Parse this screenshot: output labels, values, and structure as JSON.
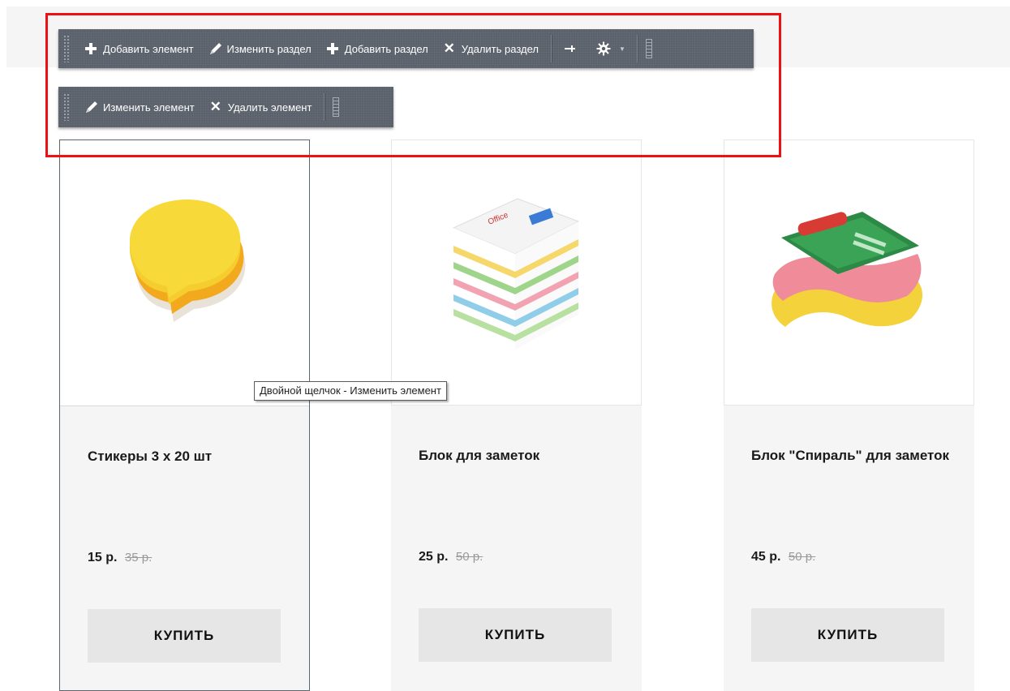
{
  "toolbar_section": {
    "add_element": "Добавить элемент",
    "edit_section": "Изменить раздел",
    "add_section": "Добавить раздел",
    "delete_section": "Удалить раздел"
  },
  "toolbar_element": {
    "edit_element": "Изменить элемент",
    "delete_element": "Удалить элемент"
  },
  "tooltip": "Двойной щелчок - Изменить элемент",
  "products": [
    {
      "title": "Стикеры 3 х 20 шт",
      "price": "15 р.",
      "old_price": "35 р.",
      "buy": "КУПИТЬ"
    },
    {
      "title": "Блок для заметок",
      "price": "25 р.",
      "old_price": "50 р.",
      "buy": "КУПИТЬ"
    },
    {
      "title": "Блок \"Спираль\" для заметок",
      "price": "45 р.",
      "old_price": "50 р.",
      "buy": "КУПИТЬ"
    }
  ],
  "colors": {
    "highlight": "#ee1111",
    "toolbar": "#5a616b",
    "card_bg": "#f5f5f5",
    "button_bg": "#e6e6e6"
  }
}
